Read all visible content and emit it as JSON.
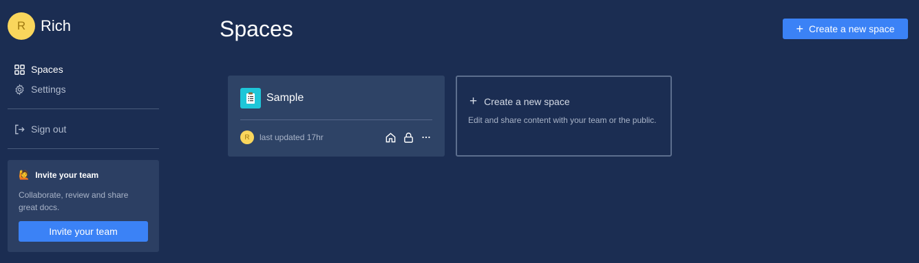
{
  "user": {
    "initial": "R",
    "name": "Rich"
  },
  "sidebar": {
    "items": [
      {
        "label": "Spaces",
        "icon": "grid-icon"
      },
      {
        "label": "Settings",
        "icon": "gear-icon"
      },
      {
        "label": "Sign out",
        "icon": "sign-out-icon"
      }
    ],
    "invite": {
      "emoji": "🙋",
      "title": "Invite your team",
      "description": "Collaborate, review and share great docs.",
      "button": "Invite your team"
    }
  },
  "main": {
    "title": "Spaces",
    "create_button": "Create a new space",
    "spaces": [
      {
        "name": "Sample",
        "icon": "clipboard-icon",
        "owner_initial": "R",
        "updated": "last updated 17hr"
      }
    ],
    "new_space_card": {
      "title": "Create a new space",
      "description": "Edit and share content with your team or the public."
    }
  },
  "colors": {
    "background": "#1b2d52",
    "accent": "#3b82f6",
    "avatar": "#f9d65c",
    "card": "#2e4366"
  }
}
